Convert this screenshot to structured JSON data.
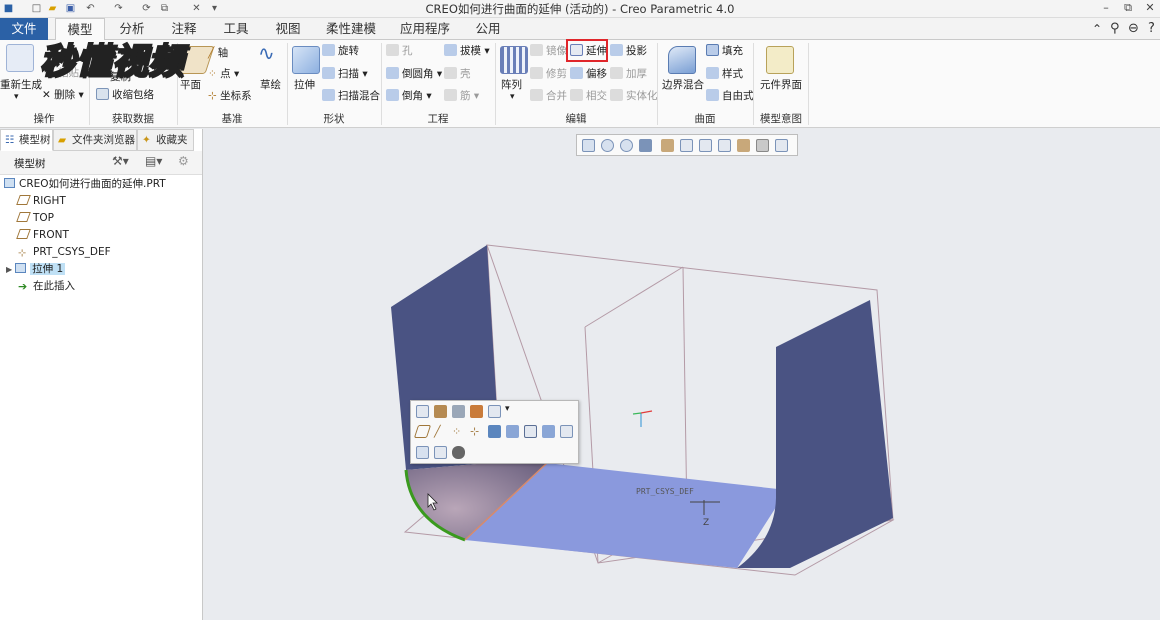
{
  "window": {
    "title": "CREO如何进行曲面的延伸 (活动的) - Creo Parametric 4.0"
  },
  "tabs": [
    "文件",
    "模型",
    "分析",
    "注释",
    "工具",
    "视图",
    "柔性建模",
    "应用程序",
    "公用"
  ],
  "ribbon": {
    "operations": {
      "regen": "重新生成",
      "paste": "粘贴",
      "delete": "删除",
      "label": "操作"
    },
    "get_data": {
      "copy_geom": "复制",
      "shrinkwrap": "收缩包络",
      "label": "获取数据"
    },
    "datum": {
      "plane": "平面",
      "axis": "轴",
      "point": "点",
      "csys": "坐标系",
      "sketch": "草绘",
      "label": "基准"
    },
    "shapes": {
      "extrude": "拉伸",
      "revolve": "旋转",
      "sweep": "扫描",
      "swept_blend": "扫描混合",
      "label": "形状"
    },
    "engineering": {
      "hole": "孔",
      "round": "倒圆角",
      "chamfer": "倒角",
      "draft": "拔模",
      "shell": "壳",
      "rib": "筋",
      "label": "工程"
    },
    "editing": {
      "pattern": "阵列",
      "mirror": "镜像",
      "extend": "延伸",
      "project": "投影",
      "trim": "修剪",
      "offset": "偏移",
      "thicken": "加厚",
      "merge": "合并",
      "intersect": "相交",
      "solidify": "实体化",
      "label": "编辑"
    },
    "surfaces": {
      "boundary_blend": "边界混合",
      "fill": "填充",
      "style": "样式",
      "freestyle": "自由式",
      "label": "曲面"
    },
    "model_intent": {
      "component_interface": "元件界面",
      "label": "模型意图"
    }
  },
  "left_panel": {
    "tabs": [
      "模型树",
      "文件夹浏览器",
      "收藏夹"
    ],
    "header": "模型树",
    "tree": [
      {
        "label": "CREO如何进行曲面的延伸.PRT",
        "icon": "part-icon"
      },
      {
        "label": "RIGHT",
        "icon": "datum-plane-icon"
      },
      {
        "label": "TOP",
        "icon": "datum-plane-icon"
      },
      {
        "label": "FRONT",
        "icon": "datum-plane-icon"
      },
      {
        "label": "PRT_CSYS_DEF",
        "icon": "csys-icon"
      },
      {
        "label": "拉伸 1",
        "icon": "extrude-icon",
        "selected": true
      },
      {
        "label": "在此插入",
        "icon": "insert-arrow-icon"
      }
    ]
  },
  "viewport": {
    "csys_label": "PRT_CSYS_DEF",
    "axis_label": "Z"
  },
  "watermark": "秒懂视频",
  "colors": {
    "file_tab": "#2b61a6",
    "highlight_box": "#e0262b",
    "surface_dark": "#4a5383",
    "surface_light": "#8a99dd",
    "edge_green": "#3a9a1e"
  }
}
